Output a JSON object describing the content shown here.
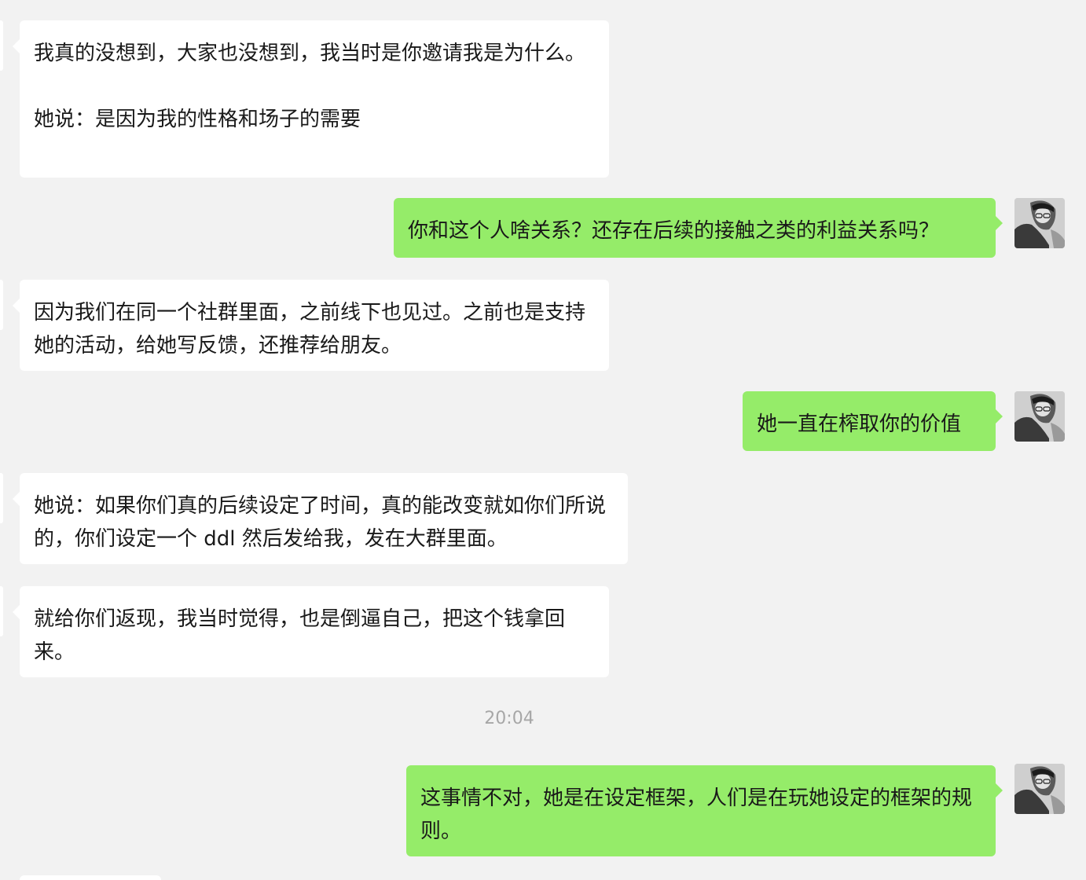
{
  "messages": [
    {
      "direction": "incoming",
      "text": "我真的没想到，大家也没想到，我当时是你邀请我是为什么。\n\n她说：是因为我的性格和场子的需要"
    },
    {
      "direction": "outgoing",
      "text": "你和这个人啥关系？还存在后续的接触之类的利益关系吗？"
    },
    {
      "direction": "incoming",
      "text": "因为我们在同一个社群里面，之前线下也见过。之前也是支持她的活动，给她写反馈，还推荐给朋友。"
    },
    {
      "direction": "outgoing",
      "text": "她一直在榨取你的价值"
    },
    {
      "direction": "incoming",
      "text": "她说：如果你们真的后续设定了时间，真的能改变就如你们所说的，你们设定一个 ddl 然后发给我，发在大群里面。"
    },
    {
      "direction": "incoming",
      "text": "就给你们返现，我当时觉得，也是倒逼自己，把这个钱拿回来。"
    },
    {
      "direction": "outgoing",
      "text": "这事情不对，她是在设定框架，人们是在玩她设定的框架的规则。"
    }
  ],
  "timestamp": "20:04",
  "colors": {
    "background": "#f2f2f2",
    "incoming_bubble": "#ffffff",
    "outgoing_bubble": "#95ec69",
    "text": "#191919",
    "timestamp": "#a7a7a7"
  },
  "icons": {
    "self_avatar": "user-avatar-icon"
  }
}
